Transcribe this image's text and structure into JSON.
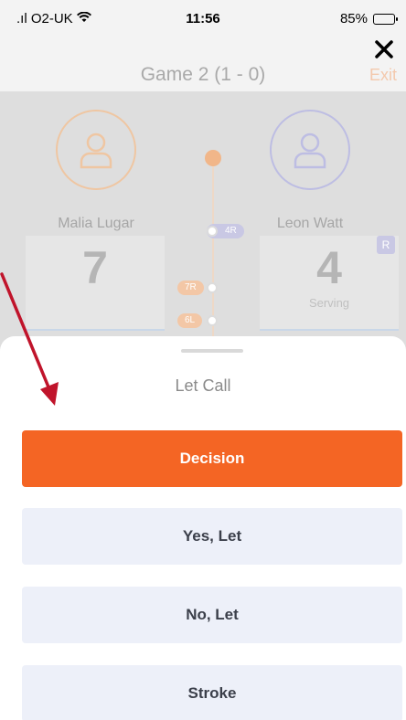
{
  "status_bar": {
    "carrier": "O2-UK",
    "time": "11:56",
    "battery": "85%",
    "battery_level": 0.85
  },
  "header": {
    "title": "Game 2 (1 - 0)",
    "exit_label": "Exit",
    "close_icon": "close-icon"
  },
  "players": {
    "left": {
      "name": "Malia Lugar",
      "score": "7",
      "accent": "#f1b689"
    },
    "right": {
      "name": "Leon Watt",
      "score": "4",
      "status": "Serving",
      "badge": "R",
      "accent": "#bdbde3"
    }
  },
  "rally_history": [
    {
      "label": "4R"
    },
    {
      "label": "7R"
    },
    {
      "label": "6L"
    }
  ],
  "sheet": {
    "title": "Let Call",
    "buttons": {
      "decision": "Decision",
      "yes_let": "Yes, Let",
      "no_let": "No, Let",
      "stroke": "Stroke"
    }
  },
  "colors": {
    "accent_orange": "#f46524",
    "option_bg": "#edf0f9",
    "annotation_arrow": "#c0142b"
  }
}
